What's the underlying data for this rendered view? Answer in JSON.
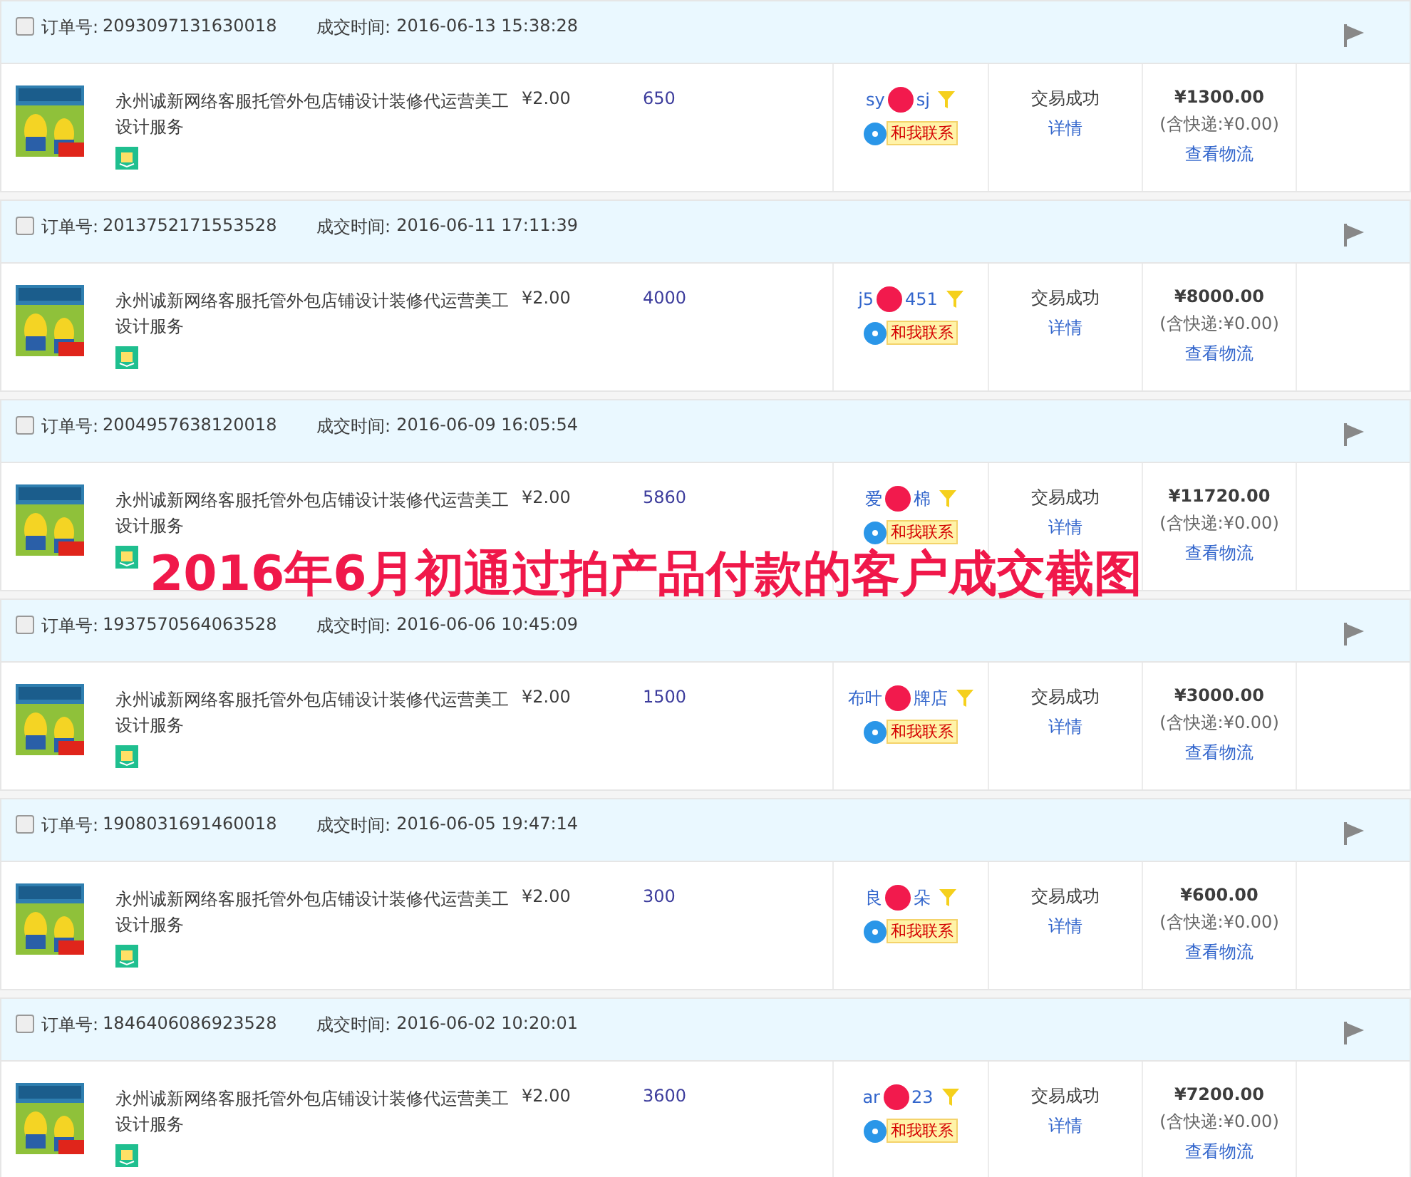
{
  "orders": [
    {
      "order_label": "订单号:",
      "order_no": "2093097131630018",
      "time_label": "成交时间:",
      "time": "2016-06-13 15:38:28",
      "checked": false,
      "title": "永州诚新网络客服托管外包店铺设计装修代运营美工设计服务",
      "price": "¥2.00",
      "quantity": "650",
      "buyer_start": "sy",
      "buyer_end": "sj",
      "contact": "和我联系",
      "status": "交易成功",
      "detail": "详情",
      "total": "¥1300.00",
      "shipping": "(含快递:¥0.00)",
      "logistics": "查看物流"
    },
    {
      "order_label": "订单号:",
      "order_no": "2013752171553528",
      "time_label": "成交时间:",
      "time": "2016-06-11 17:11:39",
      "checked": false,
      "title": "永州诚新网络客服托管外包店铺设计装修代运营美工设计服务",
      "price": "¥2.00",
      "quantity": "4000",
      "buyer_start": "j5",
      "buyer_end": "451",
      "contact": "和我联系",
      "status": "交易成功",
      "detail": "详情",
      "total": "¥8000.00",
      "shipping": "(含快递:¥0.00)",
      "logistics": "查看物流"
    },
    {
      "order_label": "订单号:",
      "order_no": "2004957638120018",
      "time_label": "成交时间:",
      "time": "2016-06-09 16:05:54",
      "checked": false,
      "title": "永州诚新网络客服托管外包店铺设计装修代运营美工设计服务",
      "price": "¥2.00",
      "quantity": "5860",
      "buyer_start": "爱",
      "buyer_end": "棉",
      "contact": "和我联系",
      "status": "交易成功",
      "detail": "详情",
      "total": "¥11720.00",
      "shipping": "(含快递:¥0.00)",
      "logistics": "查看物流"
    },
    {
      "order_label": "订单号:",
      "order_no": "1937570564063528",
      "time_label": "成交时间:",
      "time": "2016-06-06 10:45:09",
      "checked": false,
      "title": "永州诚新网络客服托管外包店铺设计装修代运营美工设计服务",
      "price": "¥2.00",
      "quantity": "1500",
      "buyer_start": "布叶",
      "buyer_end": "牌店",
      "contact": "和我联系",
      "status": "交易成功",
      "detail": "详情",
      "total": "¥3000.00",
      "shipping": "(含快递:¥0.00)",
      "logistics": "查看物流"
    },
    {
      "order_label": "订单号:",
      "order_no": "1908031691460018",
      "time_label": "成交时间:",
      "time": "2016-06-05 19:47:14",
      "checked": false,
      "title": "永州诚新网络客服托管外包店铺设计装修代运营美工设计服务",
      "price": "¥2.00",
      "quantity": "300",
      "buyer_start": "良",
      "buyer_end": "朵",
      "contact": "和我联系",
      "status": "交易成功",
      "detail": "详情",
      "total": "¥600.00",
      "shipping": "(含快递:¥0.00)",
      "logistics": "查看物流"
    },
    {
      "order_label": "订单号:",
      "order_no": "1846406086923528",
      "time_label": "成交时间:",
      "time": "2016-06-02 10:20:01",
      "checked": false,
      "title": "永州诚新网络客服托管外包店铺设计装修代运营美工设计服务",
      "price": "¥2.00",
      "quantity": "3600",
      "buyer_start": "ar",
      "buyer_end": "23",
      "contact": "和我联系",
      "status": "交易成功",
      "detail": "详情",
      "total": "¥7200.00",
      "shipping": "(含快递:¥0.00)",
      "logistics": "查看物流"
    }
  ],
  "caption": "2016年6月初通过拍产品付款的客户成交截图"
}
